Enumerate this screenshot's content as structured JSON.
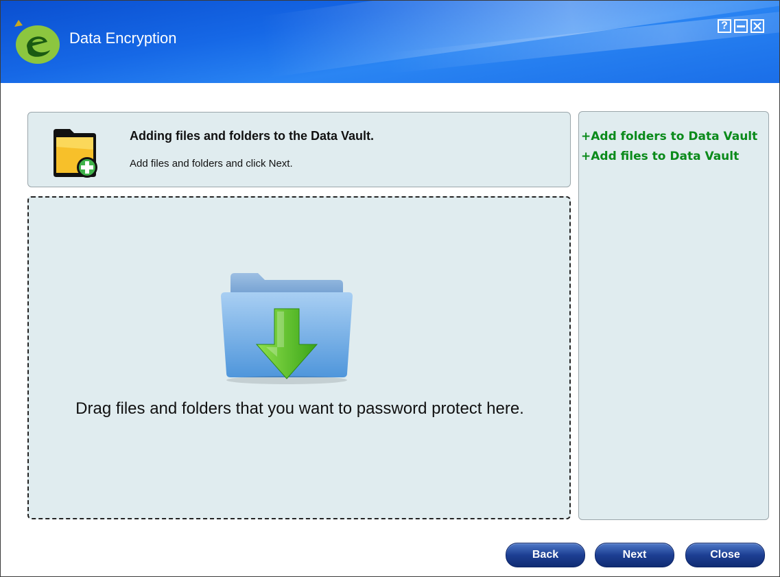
{
  "window": {
    "title": "Data Encryption",
    "controls": {
      "help": "?",
      "minimize": "—",
      "close": "✕"
    }
  },
  "header": {
    "title": "Adding files and folders to the Data Vault.",
    "subtitle": "Add files and folders and click Next.",
    "icon": "folder-add-icon"
  },
  "sidebar": {
    "links": [
      {
        "label": "+Add folders to Data Vault"
      },
      {
        "label": "+Add files to Data Vault"
      }
    ],
    "link_color": "#0a8a1a"
  },
  "drop_zone": {
    "icon": "folder-download-icon",
    "text": "Drag files and folders that you want to password protect here."
  },
  "footer": {
    "back_label": "Back",
    "next_label": "Next",
    "close_label": "Close"
  },
  "colors": {
    "titlebar": "#1668e6",
    "panel_bg": "#e0ecef",
    "button": "#1d3f93"
  }
}
